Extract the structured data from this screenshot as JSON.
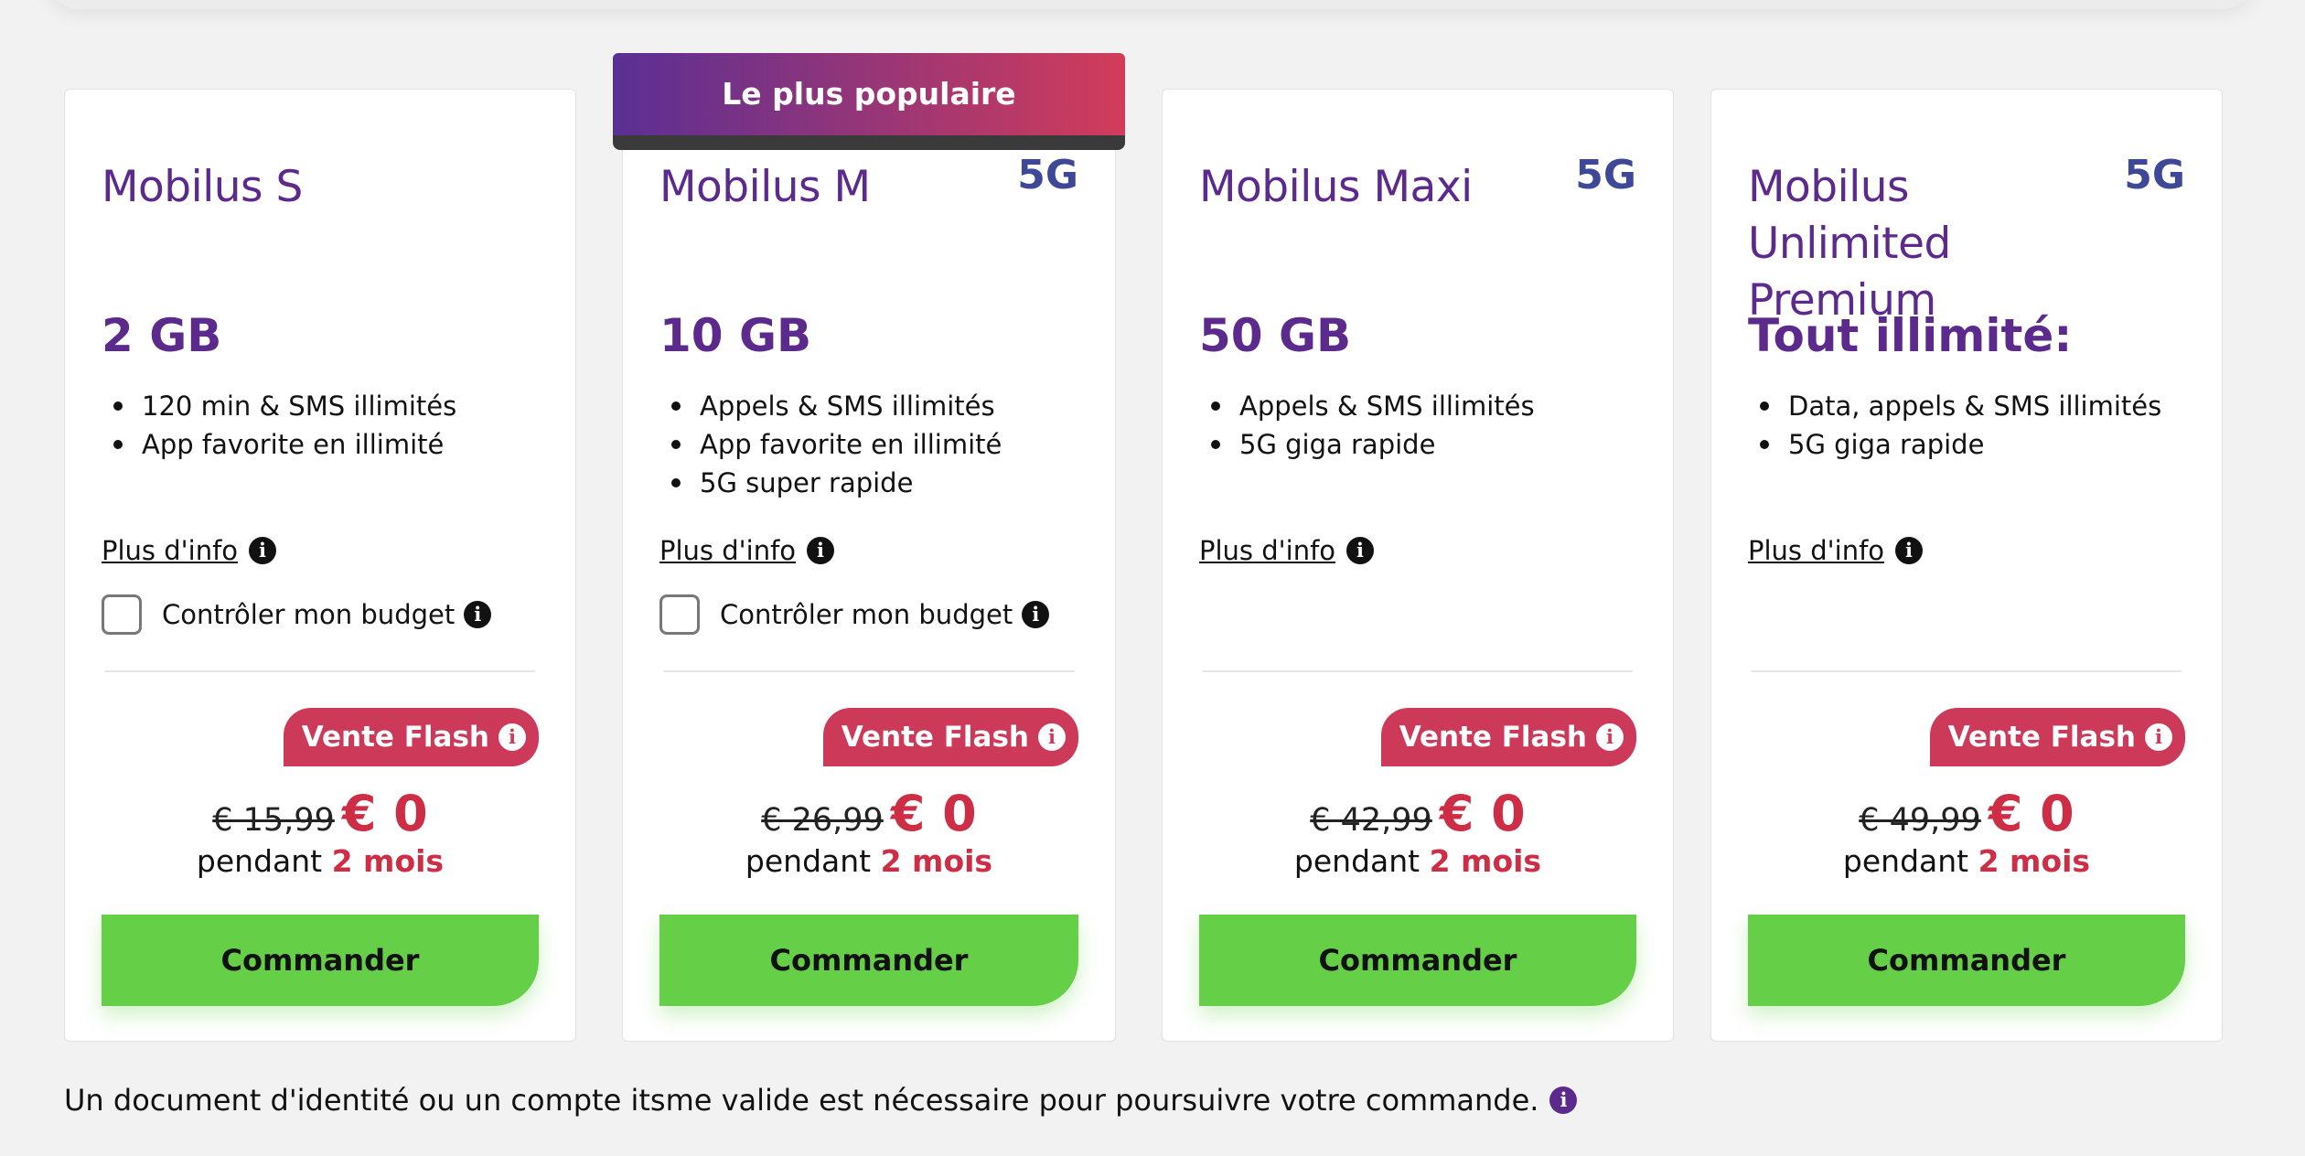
{
  "popular_label": "Le plus populaire",
  "more_info_label": "Plus d'info",
  "budget_label": "Contrôler mon budget",
  "flash_label": "Vente Flash",
  "period_prefix": "pendant",
  "order_label": "Commander",
  "footer_note": "Un document d'identité ou un compte itsme valide est nécessaire pour poursuivre votre commande.",
  "colors": {
    "brand_purple": "#5b2a8c",
    "accent_red": "#cd2d45",
    "button_green": "#66cf48"
  },
  "plans": [
    {
      "name": "Mobilus S",
      "badge": "",
      "data": "2 GB",
      "features": [
        "120 min & SMS illimités",
        "App favorite en illimité"
      ],
      "old_price": "€ 15,99",
      "new_price": "€ 0",
      "duration": "2 mois"
    },
    {
      "name": "Mobilus M",
      "badge": "5G",
      "data": "10 GB",
      "features": [
        "Appels & SMS illimités",
        "App favorite en illimité",
        "5G super rapide"
      ],
      "old_price": "€ 26,99",
      "new_price": "€ 0",
      "duration": "2 mois"
    },
    {
      "name": "Mobilus Maxi",
      "badge": "5G",
      "data": "50 GB",
      "features": [
        "Appels & SMS illimités",
        "5G giga rapide"
      ],
      "old_price": "€ 42,99",
      "new_price": "€ 0",
      "duration": "2 mois"
    },
    {
      "name": "Mobilus Unlimited Premium",
      "badge": "5G",
      "data": "Tout illimité:",
      "features": [
        "Data, appels & SMS illimités",
        "5G giga rapide"
      ],
      "old_price": "€ 49,99",
      "new_price": "€ 0",
      "duration": "2 mois"
    }
  ]
}
